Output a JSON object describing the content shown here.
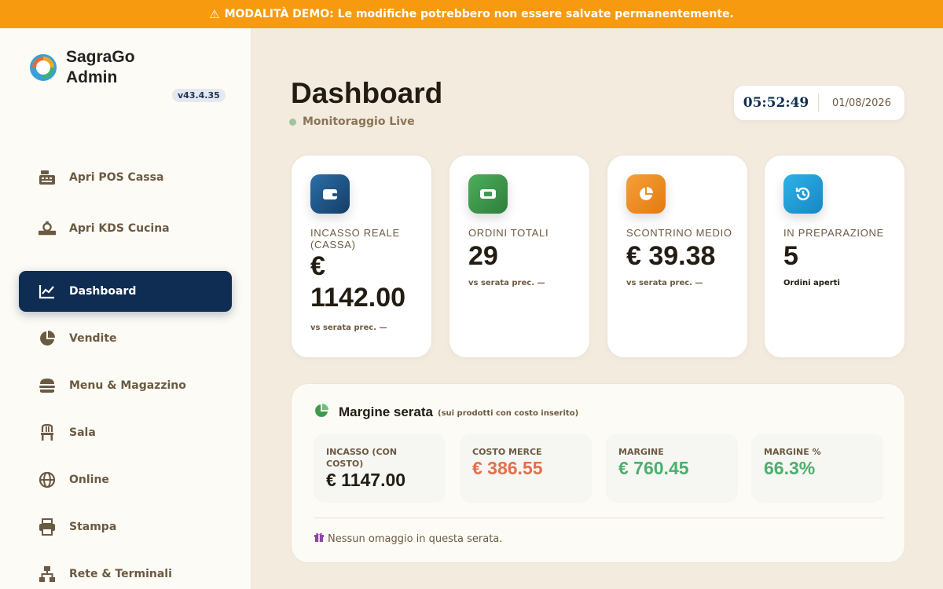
{
  "banner": {
    "text": "MODALITÀ DEMO: Le modifiche potrebbero non essere salvate permanentemente.",
    "icon": "warning-icon",
    "color": "#f79a0f"
  },
  "brand": {
    "title": "SagraGo Admin",
    "version": "v43.4.35"
  },
  "sidebar": {
    "items": [
      {
        "label": "Apri POS Cassa",
        "icon": "cash-register-icon"
      },
      {
        "label": "Apri KDS Cucina",
        "icon": "kitchen-icon"
      },
      {
        "label": "Dashboard",
        "icon": "chart-line-icon",
        "active": true
      },
      {
        "label": "Vendite",
        "icon": "pie-chart-icon"
      },
      {
        "label": "Menu & Magazzino",
        "icon": "burger-icon"
      },
      {
        "label": "Sala",
        "icon": "chair-icon"
      },
      {
        "label": "Online",
        "icon": "globe-icon"
      },
      {
        "label": "Stampa",
        "icon": "printer-icon"
      },
      {
        "label": "Rete & Terminali",
        "icon": "network-icon"
      }
    ],
    "active_color": "#0f2d52"
  },
  "header": {
    "title": "Dashboard",
    "status": "Monitoraggio Live"
  },
  "clock": {
    "time": "05:52:49",
    "date": "01/08/2026"
  },
  "stats": [
    {
      "label": "INCASSO REALE (CASSA)",
      "value": "€ 1142.00",
      "sub": "vs serata prec. —",
      "icon": "wallet-icon",
      "color": "#1e5a8c"
    },
    {
      "label": "ORDINI TOTALI",
      "value": "29",
      "sub": "vs serata prec. —",
      "icon": "ticket-icon",
      "color": "#3f9a4e"
    },
    {
      "label": "SCONTRINO MEDIO",
      "value": "€ 39.38",
      "sub": "vs serata prec. —",
      "icon": "pie-chart-icon",
      "color": "#ef8a1c"
    },
    {
      "label": "IN PREPARAZIONE",
      "value": "5",
      "sub": "Ordini aperti",
      "icon": "history-icon",
      "color": "#1f9bd6"
    }
  ],
  "margin": {
    "title": "Margine serata",
    "subtitle": "(sui prodotti con costo inserito)",
    "boxes": [
      {
        "label": "INCASSO (CON COSTO)",
        "value": "€ 1147.00",
        "color": "#221c12"
      },
      {
        "label": "COSTO MERCE",
        "value": "€ 386.55",
        "color": "#e0714a"
      },
      {
        "label": "MARGINE",
        "value": "€ 760.45",
        "color": "#4caf6e"
      },
      {
        "label": "MARGINE %",
        "value": "66.3%",
        "color": "#4caf6e"
      }
    ],
    "footer": "Nessun omaggio in questa serata."
  }
}
